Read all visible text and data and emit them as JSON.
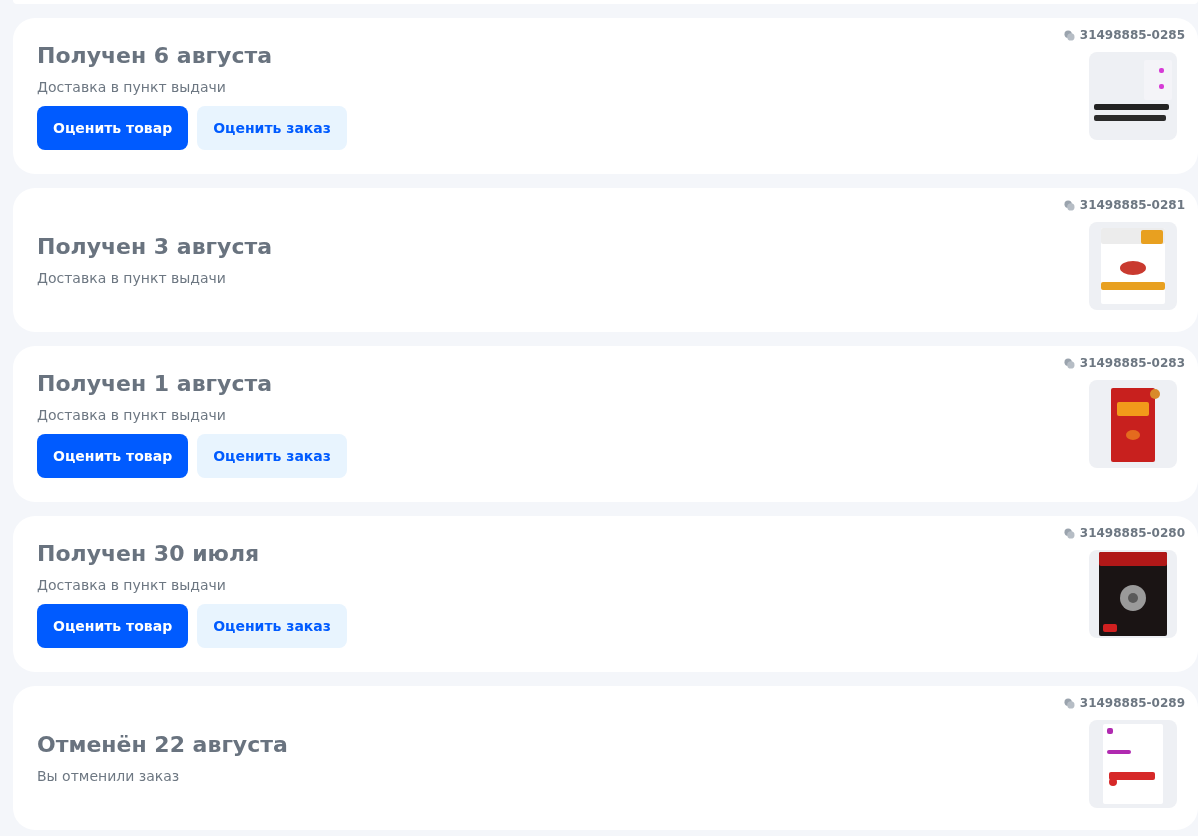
{
  "orders": [
    {
      "title": "Получен 6 августа",
      "subtitle": "Доставка в пункт выдачи",
      "number": "31498885-0285",
      "buttons": [
        {
          "label": "Оценить товар",
          "kind": "primary"
        },
        {
          "label": "Оценить заказ",
          "kind": "secondary"
        }
      ]
    },
    {
      "title": "Получен 3 августа",
      "subtitle": "Доставка в пункт выдачи",
      "number": "31498885-0281"
    },
    {
      "title": "Получен 1 августа",
      "subtitle": "Доставка в пункт выдачи",
      "number": "31498885-0283",
      "buttons": [
        {
          "label": "Оценить товар",
          "kind": "primary"
        },
        {
          "label": "Оценить заказ",
          "kind": "secondary"
        }
      ]
    },
    {
      "title": "Получен 30 июля",
      "subtitle": "Доставка в пункт выдачи",
      "number": "31498885-0280",
      "buttons": [
        {
          "label": "Оценить товар",
          "kind": "primary"
        },
        {
          "label": "Оценить заказ",
          "kind": "secondary"
        }
      ]
    },
    {
      "title": "Отменён 22 августа",
      "subtitle": "Вы отменили заказ",
      "number": "31498885-0289"
    }
  ]
}
